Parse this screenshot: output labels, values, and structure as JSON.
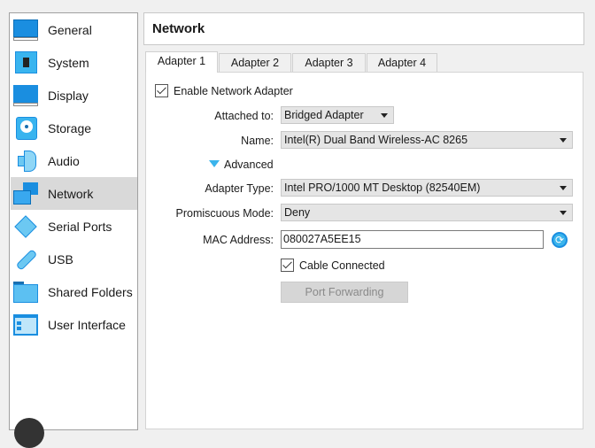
{
  "sidebar": {
    "items": [
      {
        "label": "General",
        "icon": "general-icon"
      },
      {
        "label": "System",
        "icon": "system-chip-icon"
      },
      {
        "label": "Display",
        "icon": "display-monitor-icon"
      },
      {
        "label": "Storage",
        "icon": "storage-disk-icon"
      },
      {
        "label": "Audio",
        "icon": "audio-speaker-icon"
      },
      {
        "label": "Network",
        "icon": "network-icon",
        "selected": true
      },
      {
        "label": "Serial Ports",
        "icon": "serial-port-icon"
      },
      {
        "label": "USB",
        "icon": "usb-icon"
      },
      {
        "label": "Shared Folders",
        "icon": "folder-icon"
      },
      {
        "label": "User Interface",
        "icon": "user-interface-icon"
      }
    ]
  },
  "header": {
    "title": "Network"
  },
  "tabs": [
    "Adapter 1",
    "Adapter 2",
    "Adapter 3",
    "Adapter 4"
  ],
  "form": {
    "enable_label": "Enable Network Adapter",
    "enable_checked": true,
    "attached_label": "Attached to:",
    "attached_value": "Bridged Adapter",
    "name_label": "Name:",
    "name_value": "Intel(R) Dual Band Wireless-AC 8265",
    "advanced_label": "Advanced",
    "adapter_type_label": "Adapter Type:",
    "adapter_type_value": "Intel PRO/1000 MT Desktop (82540EM)",
    "promiscuous_label": "Promiscuous Mode:",
    "promiscuous_value": "Deny",
    "mac_label": "MAC Address:",
    "mac_value": "080027A5EE15",
    "cable_label": "Cable Connected",
    "cable_checked": true,
    "port_forwarding_label": "Port Forwarding"
  },
  "colors": {
    "accent": "#1e90e0",
    "selected_bg": "#d9d9d9"
  }
}
